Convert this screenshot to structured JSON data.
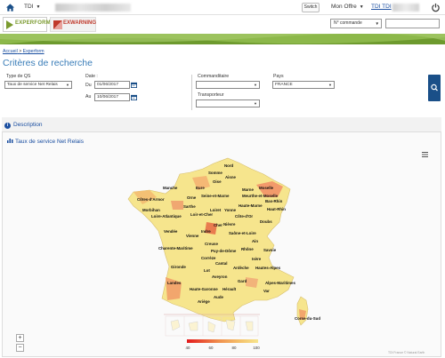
{
  "topbar": {
    "company": "TDI",
    "switch_label": "Switch",
    "mon_offre": "Mon Offre",
    "user": "TDI TDI"
  },
  "logos": {
    "experform": "EXPERFORM",
    "exwarning": "EXWARNING"
  },
  "header_search": {
    "select_value": "N° commande",
    "input_value": ""
  },
  "breadcrumb": {
    "home": "Accueil",
    "sep": ">",
    "current": "Experform"
  },
  "page": {
    "title": "Critères de recherche"
  },
  "filters": {
    "type_label": "Type de QS",
    "type_value": "Taux de service Net Relais",
    "date_label": "Date :",
    "du_label": "Du",
    "du_value": "01/06/2017",
    "au_label": "Au",
    "au_value": "10/06/2017",
    "commanditaire_label": "Commanditaire",
    "commanditaire_value": "",
    "transporteur_label": "Transporteur",
    "transporteur_value": "",
    "pays_label": "Pays",
    "pays_value": "FRANCE"
  },
  "panel": {
    "description": "Description",
    "chart_title": "Taux de service Net Relais",
    "credits": "TDI France © Natural Earth"
  },
  "colors": {
    "brand_blue": "#1a4f88",
    "link_blue": "#1a4ea0",
    "green_bar": "#7fae3a",
    "map_base": "#f6e58d",
    "map_mid": "#f5c26b",
    "map_low": "#e97b4f"
  },
  "chart_data": {
    "type": "heatmap",
    "title": "",
    "departments": [
      {
        "name": "Nord"
      },
      {
        "name": "Somme"
      },
      {
        "name": "Aisne"
      },
      {
        "name": "Oise"
      },
      {
        "name": "Manche"
      },
      {
        "name": "Eure"
      },
      {
        "name": "Moselle"
      },
      {
        "name": "Seine-et-Marne"
      },
      {
        "name": "Marne"
      },
      {
        "name": "Meurthe-et-Moselle"
      },
      {
        "name": "Côtes-d'Armor"
      },
      {
        "name": "Orne"
      },
      {
        "name": "Bas-Rhin"
      },
      {
        "name": "Sarthe"
      },
      {
        "name": "Loiret"
      },
      {
        "name": "Yonne"
      },
      {
        "name": "Haute-Marne"
      },
      {
        "name": "Haut-Rhin"
      },
      {
        "name": "Morbihan"
      },
      {
        "name": "Loir-et-Cher"
      },
      {
        "name": "Côte-d'Or"
      },
      {
        "name": "Loire-Atlantique"
      },
      {
        "name": "Doubs"
      },
      {
        "name": "Nièvre"
      },
      {
        "name": "Cher"
      },
      {
        "name": "Vendée"
      },
      {
        "name": "Indre"
      },
      {
        "name": "Saône-et-Loire"
      },
      {
        "name": "Vienne"
      },
      {
        "name": "Ain"
      },
      {
        "name": "Creuse"
      },
      {
        "name": "Rhône"
      },
      {
        "name": "Charente-Maritime"
      },
      {
        "name": "Puy-de-Dôme"
      },
      {
        "name": "Savoie"
      },
      {
        "name": "Corrèze"
      },
      {
        "name": "Isère"
      },
      {
        "name": "Cantal"
      },
      {
        "name": "Hautes-Alpes"
      },
      {
        "name": "Gironde"
      },
      {
        "name": "Lot"
      },
      {
        "name": "Ardèche"
      },
      {
        "name": "Aveyron"
      },
      {
        "name": "Alpes-Maritimes"
      },
      {
        "name": "Landes"
      },
      {
        "name": "Gard"
      },
      {
        "name": "Var"
      },
      {
        "name": "Haute-Garonne"
      },
      {
        "name": "Hérault"
      },
      {
        "name": "Aude"
      },
      {
        "name": "Ariège"
      },
      {
        "name": "Corse-du-Sud"
      }
    ],
    "legend_ticks": [
      "40",
      "60",
      "80",
      "100"
    ],
    "legend_range": [
      40,
      100
    ],
    "legend_colors": [
      "#e31a1c",
      "#f5c26b",
      "#f6e58d"
    ]
  }
}
